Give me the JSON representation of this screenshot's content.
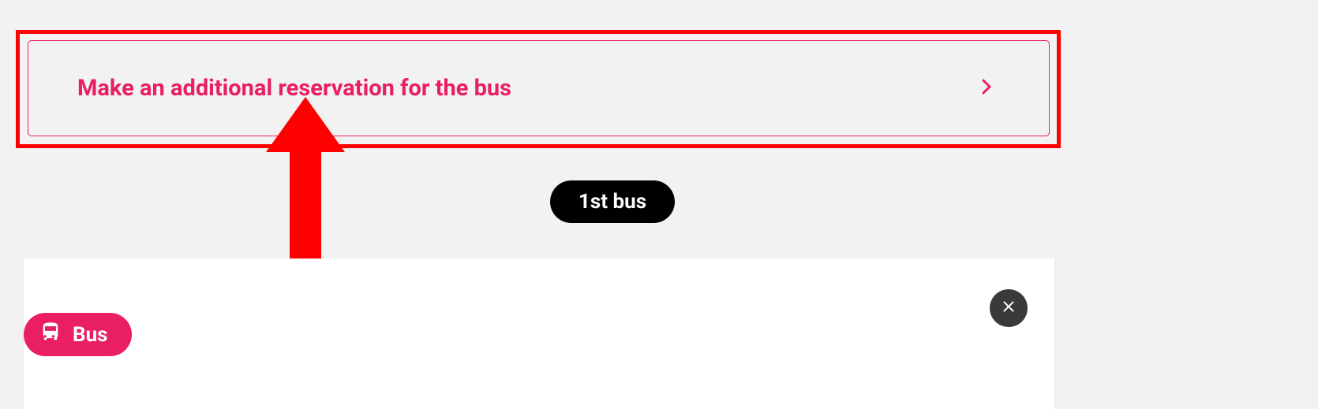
{
  "banner": {
    "label": "Make an additional reservation for the bus"
  },
  "badge": {
    "label": "1st bus"
  },
  "card": {
    "tag_label": "Bus"
  },
  "colors": {
    "accent": "#e91e63",
    "highlight": "#ff0000"
  }
}
